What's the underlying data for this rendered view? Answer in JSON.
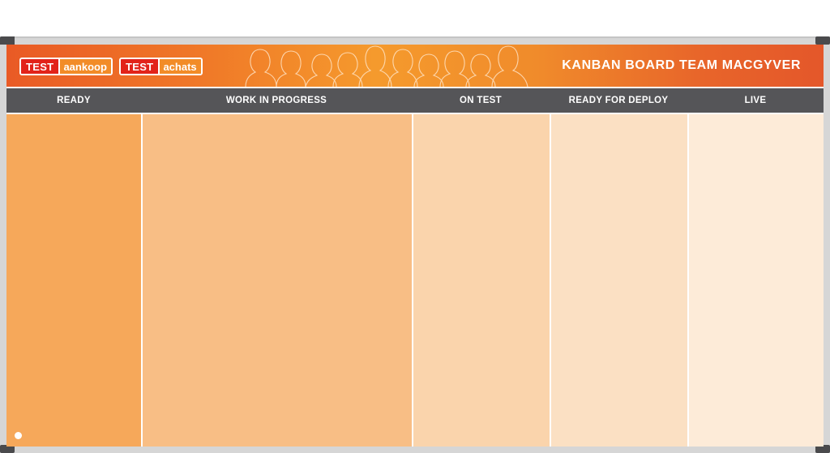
{
  "logos": [
    {
      "part_a": "TEST",
      "part_b": "aankoop"
    },
    {
      "part_a": "TEST",
      "part_b": "achats"
    }
  ],
  "board_title": "KANBAN BOARD TEAM MACGYVER",
  "columns": [
    {
      "label": "READY",
      "color": "#f6a85a"
    },
    {
      "label": "WORK IN PROGRESS",
      "color": "#f8be85"
    },
    {
      "label": "ON TEST",
      "color": "#fad4ac"
    },
    {
      "label": "READY FOR DEPLOY",
      "color": "#fbe0c3"
    },
    {
      "label": "LIVE",
      "color": "#fdebd8"
    }
  ],
  "colors": {
    "banner_accent": "#f08b2b",
    "header_bar": "#555558",
    "frame": "#d6d6d6"
  },
  "icons": {
    "brand_mark": "leaf-logo-icon",
    "banner_art": "people-silhouettes-illustration"
  }
}
